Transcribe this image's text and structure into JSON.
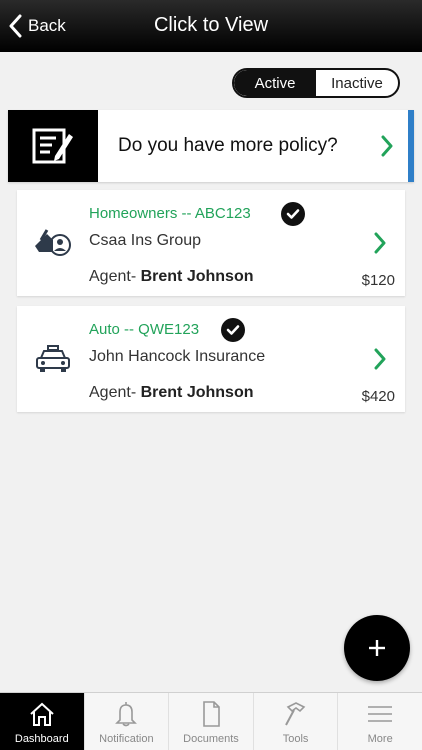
{
  "header": {
    "back_label": "Back",
    "title": "Click to View"
  },
  "segment": {
    "active_label": "Active",
    "inactive_label": "Inactive",
    "selected": "Active"
  },
  "promo": {
    "text": "Do you have more policy?",
    "icon": "document-edit-icon",
    "accent_color": "#2f7fc8"
  },
  "policies": [
    {
      "title": "Homeowners -- ABC123",
      "company": "Csaa Ins Group",
      "agent_prefix": "Agent-",
      "agent_name": "Brent Johnson",
      "price": "$120",
      "icon": "home-person-icon"
    },
    {
      "title": "Auto -- QWE123",
      "company": "John Hancock Insurance",
      "agent_prefix": "Agent-",
      "agent_name": "Brent Johnson",
      "price": "$420",
      "icon": "car-icon"
    }
  ],
  "tabs": [
    {
      "label": "Dashboard",
      "icon": "home-icon",
      "active": true
    },
    {
      "label": "Notification",
      "icon": "bell-icon",
      "active": false
    },
    {
      "label": "Documents",
      "icon": "document-icon",
      "active": false
    },
    {
      "label": "Tools",
      "icon": "hammer-icon",
      "active": false
    },
    {
      "label": "More",
      "icon": "menu-icon",
      "active": false
    }
  ],
  "colors": {
    "green": "#22a35a",
    "accent_blue": "#2f7fc8",
    "black": "#000000"
  }
}
